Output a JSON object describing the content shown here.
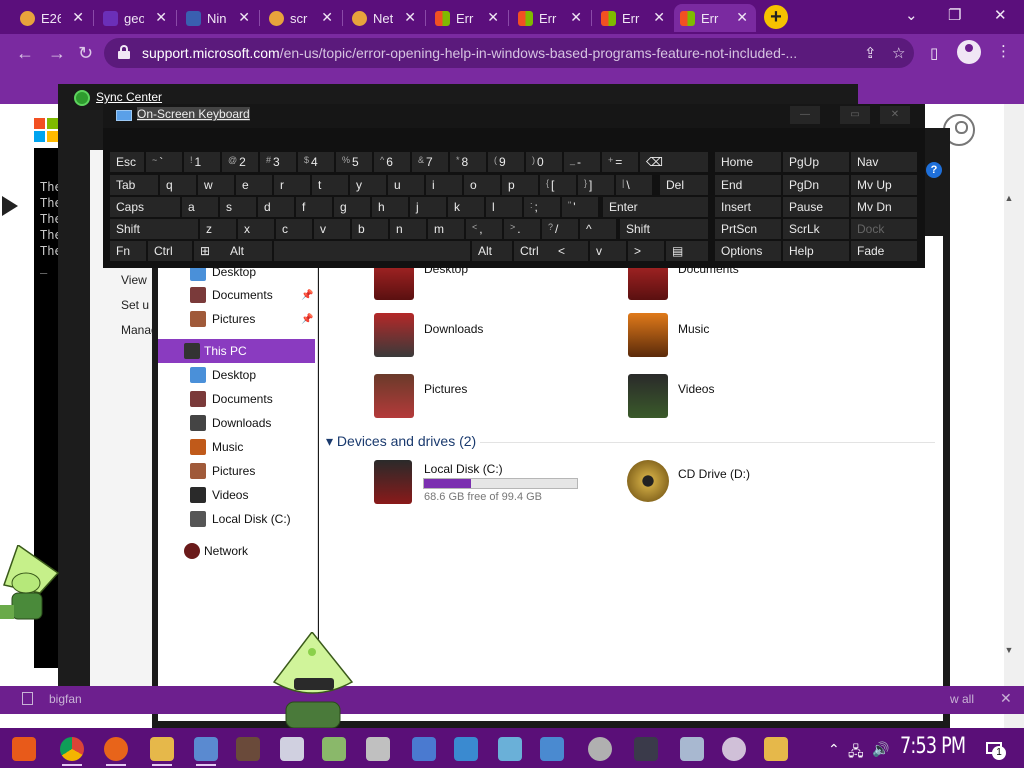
{
  "browser": {
    "tabs": [
      {
        "title": "E26",
        "favicon_color": "#e8a33c"
      },
      {
        "title": "geo",
        "favicon_color": "#6b2fb8"
      },
      {
        "title": "Nin",
        "favicon_color": "#3a5fb0"
      },
      {
        "title": "scr",
        "favicon_color": "#e8a33c"
      },
      {
        "title": "Net",
        "favicon_color": "#e8a33c"
      },
      {
        "title": "Err",
        "favicon_color": "#f25022"
      },
      {
        "title": "Err",
        "favicon_color": "#f25022"
      },
      {
        "title": "Err",
        "favicon_color": "#f25022"
      },
      {
        "title": "Err",
        "favicon_color": "#f25022"
      }
    ],
    "new_tab_icon": "+",
    "window_controls": {
      "minimize": "⌄",
      "restore": "❐",
      "close": "✕"
    },
    "nav": {
      "back": "←",
      "forward": "→",
      "reload": "↻"
    },
    "url_host": "support.microsoft.com",
    "url_path": "/en-us/topic/error-opening-help-in-windows-based-programs-feature-not-included-...",
    "share_icon": "⇪",
    "bookmark_icon": "☆"
  },
  "sync_center": {
    "title": "Sync Center",
    "links": [
      "View",
      "Set u",
      "Manag"
    ]
  },
  "command_prompt": {
    "lines": [
      "The",
      "The",
      "The",
      "The",
      "The",
      "_"
    ]
  },
  "osk": {
    "title": "On-Screen Keyboard",
    "controls": {
      "minimize": "—",
      "maximize": "▭",
      "close": "✕"
    },
    "rows": [
      [
        {
          "label": "Esc"
        },
        {
          "shift": "~",
          "label": "`"
        },
        {
          "shift": "!",
          "label": "1"
        },
        {
          "shift": "@",
          "label": "2"
        },
        {
          "shift": "#",
          "label": "3"
        },
        {
          "shift": "$",
          "label": "4"
        },
        {
          "shift": "%",
          "label": "5"
        },
        {
          "shift": "^",
          "label": "6"
        },
        {
          "shift": "&",
          "label": "7"
        },
        {
          "shift": "*",
          "label": "8"
        },
        {
          "shift": "(",
          "label": "9"
        },
        {
          "shift": ")",
          "label": "0"
        },
        {
          "shift": "_",
          "label": "-"
        },
        {
          "shift": "+",
          "label": "="
        },
        {
          "label": "⌫"
        },
        {
          "label": "Home"
        },
        {
          "label": "PgUp"
        },
        {
          "label": "Nav"
        }
      ],
      [
        {
          "label": "Tab"
        },
        {
          "label": "q"
        },
        {
          "label": "w"
        },
        {
          "label": "e"
        },
        {
          "label": "r"
        },
        {
          "label": "t"
        },
        {
          "label": "y"
        },
        {
          "label": "u"
        },
        {
          "label": "i"
        },
        {
          "label": "o"
        },
        {
          "label": "p"
        },
        {
          "shift": "{",
          "label": "["
        },
        {
          "shift": "}",
          "label": "]"
        },
        {
          "shift": "|",
          "label": "\\"
        },
        {
          "label": "Del"
        },
        {
          "label": "End"
        },
        {
          "label": "PgDn"
        },
        {
          "label": "Mv Up"
        }
      ],
      [
        {
          "label": "Caps"
        },
        {
          "label": "a"
        },
        {
          "label": "s"
        },
        {
          "label": "d"
        },
        {
          "label": "f"
        },
        {
          "label": "g"
        },
        {
          "label": "h"
        },
        {
          "label": "j"
        },
        {
          "label": "k"
        },
        {
          "label": "l"
        },
        {
          "shift": ":",
          "label": ";"
        },
        {
          "shift": "\"",
          "label": "'"
        },
        {
          "label": "Enter"
        },
        {
          "label": "Insert"
        },
        {
          "label": "Pause"
        },
        {
          "label": "Mv Dn"
        }
      ],
      [
        {
          "label": "Shift"
        },
        {
          "label": "z"
        },
        {
          "label": "x"
        },
        {
          "label": "c"
        },
        {
          "label": "v"
        },
        {
          "label": "b"
        },
        {
          "label": "n"
        },
        {
          "label": "m"
        },
        {
          "shift": "<",
          "label": ","
        },
        {
          "shift": ">",
          "label": "."
        },
        {
          "shift": "?",
          "label": "/"
        },
        {
          "label": "^"
        },
        {
          "label": "Shift"
        },
        {
          "label": "PrtScn"
        },
        {
          "label": "ScrLk"
        },
        {
          "label": "Dock",
          "dim": true
        }
      ],
      [
        {
          "label": "Fn"
        },
        {
          "label": "Ctrl"
        },
        {
          "label": "⊞"
        },
        {
          "label": "Alt"
        },
        {
          "label": ""
        },
        {
          "label": "Alt"
        },
        {
          "label": "Ctrl"
        },
        {
          "label": "<"
        },
        {
          "label": "v"
        },
        {
          "label": ">"
        },
        {
          "label": "▤"
        },
        {
          "label": "Options"
        },
        {
          "label": "Help"
        },
        {
          "label": "Fade"
        }
      ]
    ]
  },
  "explorer": {
    "nav_items": [
      "Desktop",
      "Documents",
      "Pictures",
      "This PC",
      "Desktop",
      "Documents",
      "Downloads",
      "Music",
      "Pictures",
      "Videos",
      "Local Disk (C:)",
      "Network"
    ],
    "folders": [
      "Desktop",
      "Documents",
      "Downloads",
      "Music",
      "Pictures",
      "Videos"
    ],
    "section_header": "Devices and drives (2)",
    "section_toggle": "▾",
    "drives": [
      {
        "name": "Local Disk (C:)",
        "free_text": "68.6 GB free of 99.4 GB",
        "used_fraction": 0.31
      },
      {
        "name": "CD Drive (D:)"
      }
    ]
  },
  "page": {
    "bigfan_text": "bigfan",
    "see_all_text": "w all",
    "close_icon": "✕"
  },
  "taskbar": {
    "clock": "7:53 PM",
    "notification_count": "1",
    "icons": [
      "start",
      "chrome",
      "firefox",
      "file-explorer",
      "control-panel",
      "tool",
      "task-manager",
      "network",
      "paint",
      "screenshot",
      "remote-desktop",
      "settings",
      "image",
      "disc",
      "terminal",
      "folder-cube",
      "clock-app",
      "folder"
    ],
    "tray": {
      "chevron": "⌃",
      "network": "🖧",
      "volume": "🔊"
    }
  }
}
